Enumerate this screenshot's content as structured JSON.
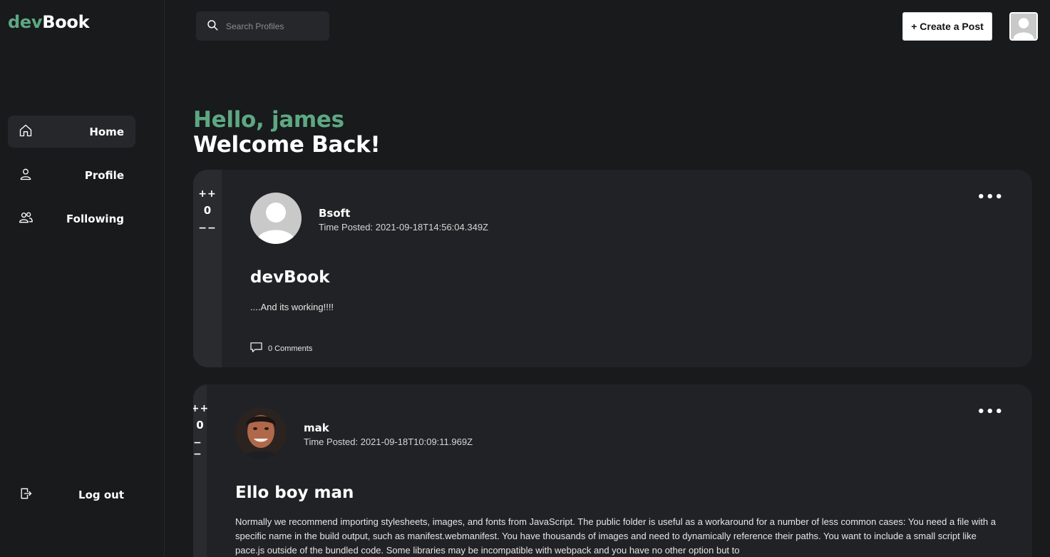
{
  "brand": {
    "prefix": "dev",
    "suffix": "Book"
  },
  "search": {
    "placeholder": "Search Profiles"
  },
  "header": {
    "create_post": "+ Create a Post"
  },
  "sidebar": {
    "items": [
      {
        "label": "Home",
        "icon": "home-icon"
      },
      {
        "label": "Profile",
        "icon": "user-icon"
      },
      {
        "label": "Following",
        "icon": "users-icon"
      }
    ],
    "logout": {
      "label": "Log out",
      "icon": "logout-icon"
    }
  },
  "greeting": {
    "hello": "Hello, james",
    "welcome": "Welcome Back!"
  },
  "posts": [
    {
      "upvote": "++",
      "votes": "0",
      "downvote": "−−",
      "author": "Bsoft",
      "time": "Time Posted: 2021-09-18T14:56:04.349Z",
      "title": "devBook",
      "body": "....And its working!!!!",
      "comments": "0 Comments",
      "menu": "•••"
    },
    {
      "upvote": "++",
      "votes": "0",
      "downvote": "−−",
      "author": "mak",
      "time": "Time Posted: 2021-09-18T10:09:11.969Z",
      "title": "Ello boy man",
      "body": "Normally we recommend importing stylesheets, images, and fonts from JavaScript. The public folder is useful as a workaround for a number of less common cases: You need a file with a specific name in the build output, such as manifest.webmanifest. You have thousands of images and need to dynamically reference their paths. You want to include a small script like pace.js outside of the bundled code. Some libraries may be incompatible with webpack and you have no other option but to",
      "menu": "•••"
    }
  ],
  "colors": {
    "accent": "#5da883",
    "background": "#181a1c",
    "card": "#212225"
  }
}
